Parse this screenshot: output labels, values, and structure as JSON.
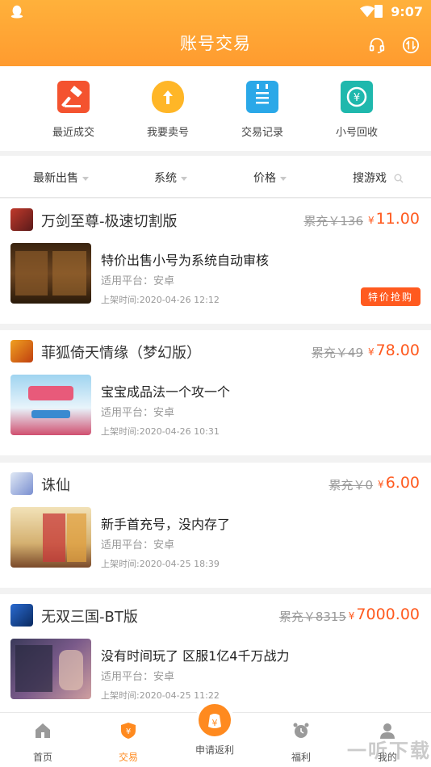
{
  "status": {
    "time": "9:07"
  },
  "header": {
    "title": "账号交易"
  },
  "quick_actions": [
    {
      "label": "最近成交",
      "icon": "hammer-icon",
      "color": "#f4532f"
    },
    {
      "label": "我要卖号",
      "icon": "money-bag-icon",
      "color": "#ffb627"
    },
    {
      "label": "交易记录",
      "icon": "notepad-icon",
      "color": "#2aa8e8"
    },
    {
      "label": "小号回收",
      "icon": "recycle-yen-icon",
      "color": "#1fb8ad"
    }
  ],
  "filters": {
    "newest": "最新出售",
    "system": "系统",
    "price": "价格",
    "search": "搜游戏"
  },
  "listings": [
    {
      "game": "万剑至尊-极速切割版",
      "old_price": "累充￥136",
      "currency": "¥",
      "price": "11.00",
      "desc": "特价出售小号为系统自动审核",
      "platform": "适用平台：安卓",
      "time": "上架时间:2020-04-26 12:12",
      "badge": "特价抢购"
    },
    {
      "game": "菲狐倚天情缘（梦幻版）",
      "old_price": "累充￥49",
      "currency": "¥",
      "price": "78.00",
      "desc": "宝宝成品法一个攻一个",
      "platform": "适用平台：安卓",
      "time": "上架时间:2020-04-26 10:31"
    },
    {
      "game": "诛仙",
      "old_price": "累充￥0",
      "currency": "¥",
      "price": "6.00",
      "desc": "新手首充号，没内存了",
      "platform": "适用平台：安卓",
      "time": "上架时间:2020-04-25 18:39"
    },
    {
      "game": "无双三国-BT版",
      "old_price": "累充￥8315",
      "currency": "¥",
      "price": "7000.00",
      "desc": "没有时间玩了  区服1亿4千万战力",
      "platform": "适用平台：安卓",
      "time": "上架时间:2020-04-25 11:22"
    }
  ],
  "tabs": {
    "home": "首页",
    "trade": "交易",
    "rebate": "申请返利",
    "welfare": "福利",
    "mine": "我的"
  },
  "watermark": "一听下载",
  "colors": {
    "accent": "#ff9b2f",
    "price": "#ff5a1f"
  }
}
